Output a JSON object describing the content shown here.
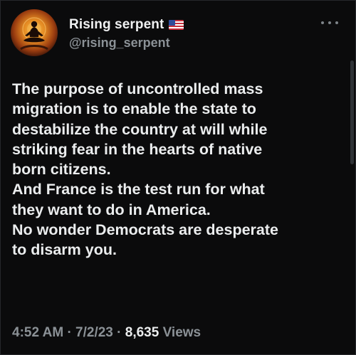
{
  "tweet": {
    "display_name": "Rising serpent",
    "handle": "@rising_serpent",
    "flag_icon": "us-flag-icon",
    "more_icon": "more-options-icon",
    "lines": [
      "The purpose of uncontrolled mass",
      "migration is to enable the state to",
      "destabilize the country at will while",
      "striking fear in the hearts of native",
      "born citizens.",
      "And France is the test run for what",
      "they want to do in America.",
      "No wonder Democrats are desperate",
      "to disarm you."
    ],
    "time": "4:52 AM",
    "date": "7/2/23",
    "separator": "·",
    "views_count": "8,635",
    "views_label": "Views"
  },
  "colors": {
    "background": "#0b0b0c",
    "text": "#ebedee",
    "secondary_text": "#8b9196"
  }
}
